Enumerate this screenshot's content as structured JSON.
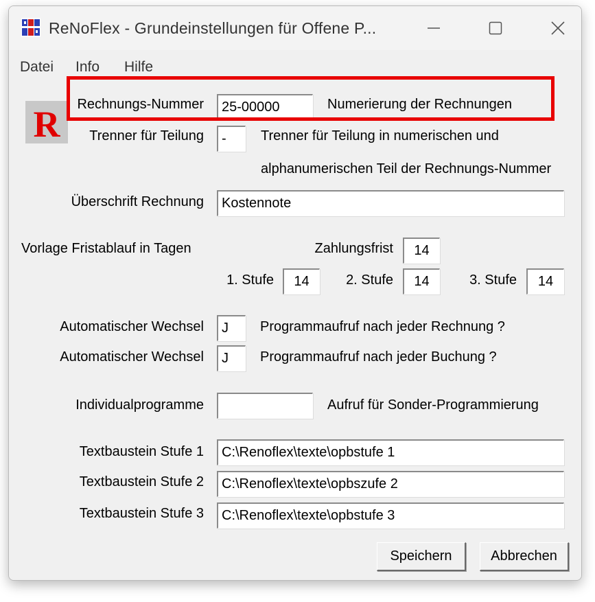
{
  "window": {
    "title": "ReNoFlex  -  Grundeinstellungen für Offene P...",
    "logo_letter": "R"
  },
  "menu": [
    "Datei",
    "Info",
    "Hilfe"
  ],
  "form": {
    "rechnungs_nummer": {
      "label": "Rechnungs-Nummer",
      "value": "25-00000",
      "hint": "Numerierung der Rechnungen"
    },
    "trenner": {
      "label": "Trenner für Teilung",
      "value": "-",
      "hint_line1": "Trenner für Teilung in numerischen und",
      "hint_line2": "alphanumerischen Teil der Rechnungs-Nummer"
    },
    "ueberschrift": {
      "label": "Überschrift Rechnung",
      "value": "Kostennote"
    },
    "frist": {
      "label": "Vorlage Fristablauf in Tagen",
      "zahlungsfrist_label": "Zahlungsfrist",
      "zahlungsfrist": "14",
      "stufe1_label": "1. Stufe",
      "stufe1": "14",
      "stufe2_label": "2. Stufe",
      "stufe2": "14",
      "stufe3_label": "3. Stufe",
      "stufe3": "14"
    },
    "wechsel_rechnung": {
      "label": "Automatischer Wechsel",
      "value": "J",
      "hint": "Programmaufruf nach jeder Rechnung ?"
    },
    "wechsel_buchung": {
      "label": "Automatischer Wechsel",
      "value": "J",
      "hint": "Programmaufruf nach jeder Buchung ?"
    },
    "individual": {
      "label": "Individualprogramme",
      "value": "",
      "hint": "Aufruf für Sonder-Programmierung"
    },
    "textbaustein1": {
      "label": "Textbaustein Stufe 1",
      "value": "C:\\Renoflex\\texte\\opbstufe 1"
    },
    "textbaustein2": {
      "label": "Textbaustein Stufe 2",
      "value": "C:\\Renoflex\\texte\\opbszufe 2"
    },
    "textbaustein3": {
      "label": "Textbaustein Stufe 3",
      "value": "C:\\Renoflex\\texte\\opbstufe 3"
    }
  },
  "buttons": {
    "save": "Speichern",
    "cancel": "Abbrechen"
  },
  "colors": {
    "highlight": "#e80000",
    "logo_red": "#e00000",
    "window_bg": "#f0f0f0"
  }
}
